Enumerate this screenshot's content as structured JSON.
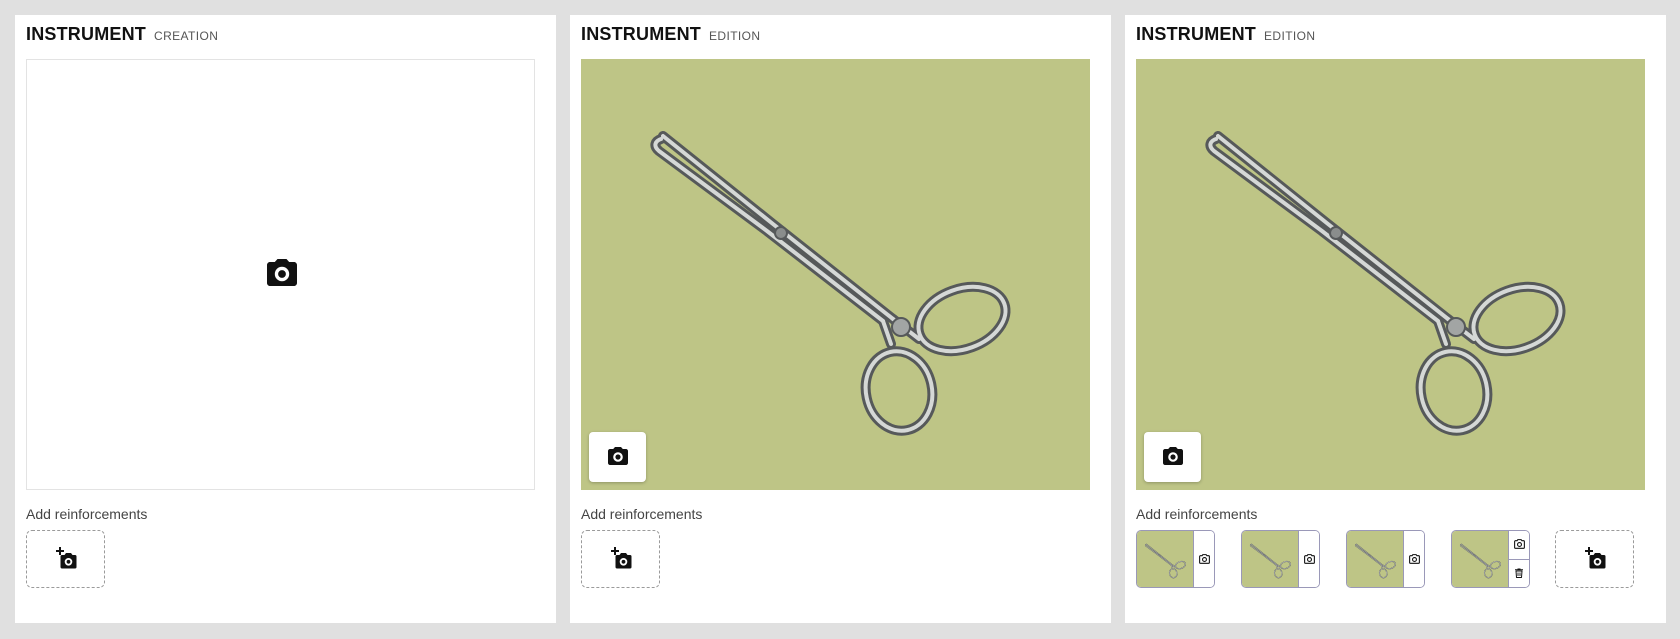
{
  "panels": [
    {
      "title": "INSTRUMENT",
      "mode": "CREATION",
      "reinforcements_label": "Add reinforcements"
    },
    {
      "title": "INSTRUMENT",
      "mode": "EDITION",
      "reinforcements_label": "Add reinforcements"
    },
    {
      "title": "INSTRUMENT",
      "mode": "EDITION",
      "reinforcements_label": "Add reinforcements"
    }
  ],
  "icons": {
    "camera": "camera-icon",
    "add_photo": "add-photo-icon",
    "delete": "trash-icon",
    "instrument": "forceps-image"
  },
  "colors": {
    "photo_background": "#bec586",
    "page_background": "#e0e0e0",
    "thumb_border": "#9a98b8"
  }
}
